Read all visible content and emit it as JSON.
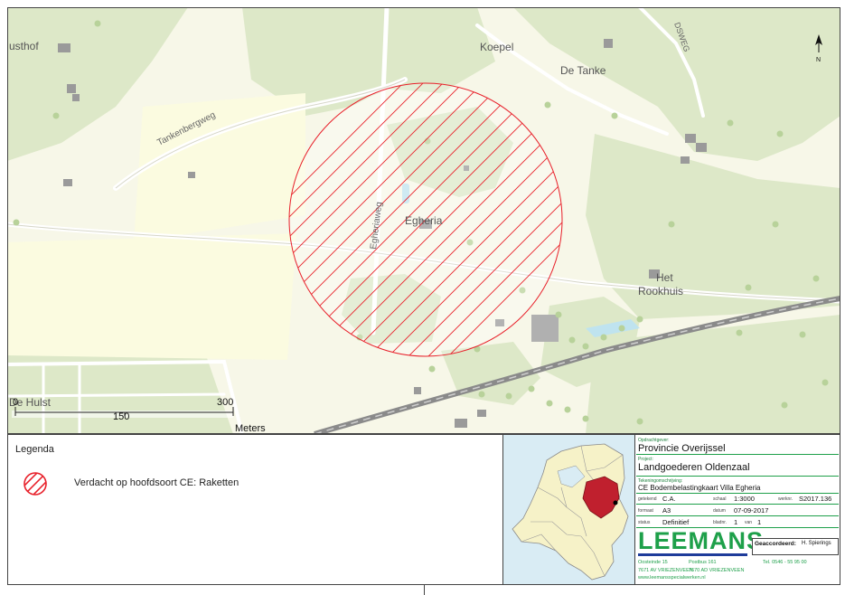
{
  "map": {
    "place_labels": [
      {
        "id": "husthof",
        "text": "usthof"
      },
      {
        "id": "koepel",
        "text": "Koepel"
      },
      {
        "id": "de-tanke",
        "text": "De Tanke"
      },
      {
        "id": "tankenbergweg",
        "text": "Tankenbergweg"
      },
      {
        "id": "egheria",
        "text": "Egheria"
      },
      {
        "id": "egheriaweg",
        "text": "Egheriaweg"
      },
      {
        "id": "het",
        "text": "Het"
      },
      {
        "id": "rookhuis",
        "text": "Rookhuis"
      },
      {
        "id": "de-hulst",
        "text": "De Hulst"
      },
      {
        "id": "dsweg",
        "text": "DSWEG"
      }
    ],
    "north_label": "N",
    "scale_bar": {
      "ticks": [
        "0",
        "150",
        "300"
      ],
      "unit": "Meters"
    },
    "colors": {
      "base": "#f7f7e8",
      "forest": "#dde8c8",
      "road": "#ffffff",
      "rail": "#7a7a7a",
      "hatch": "#e8202a",
      "water": "#bfe3ef",
      "building": "#9a9a9a"
    }
  },
  "legend": {
    "title": "Legenda",
    "items": [
      {
        "label": "Verdacht op hoofdsoort CE: Raketten",
        "symbol": "red-hatched-circle",
        "color": "#e8202a"
      }
    ]
  },
  "inset_map": {
    "highlight_color": "#c0202e",
    "land_color": "#f6f2c8",
    "water_color": "#d9ecf4"
  },
  "title_block": {
    "opdrachtgever_label": "Opdrachtgever:",
    "opdrachtgever": "Provincie Overijssel",
    "project_label": "Project:",
    "project": "Landgoederen Oldenzaal",
    "omschrijving_label": "Tekeningomschrijving:",
    "omschrijving": "CE Bodembelastingkaart Villa Egheria",
    "getekend_label": "getekend",
    "getekend": "C.A.",
    "schaal_label": "schaal",
    "schaal": "1:3000",
    "werknr_label": "werknr.",
    "werknr": "S2017.136",
    "formaat_label": "formaat",
    "formaat": "A3",
    "datum_label": "datum",
    "datum": "07-09-2017",
    "status_label": "status",
    "status": "Definitief",
    "blad_label": "bladnr.",
    "blad": "1",
    "van_label": "van",
    "van": "1",
    "geaccordeerd_label": "Geaccordeerd:",
    "geaccordeerd": "H. Spierings",
    "company": "LEEMANS",
    "company_color": "#1ea04a",
    "address_line1_left": "Oosteinde 15",
    "address_line1_mid": "Postbus 161",
    "address_line1_right": "Tel. 0546 - 55 95 00",
    "address_line2_left": "7671 AV  VRIEZENVEEN",
    "address_line2_mid": "7670 AD  VRIEZENVEEN",
    "website": "www.leemansspecialwerken.nl"
  }
}
